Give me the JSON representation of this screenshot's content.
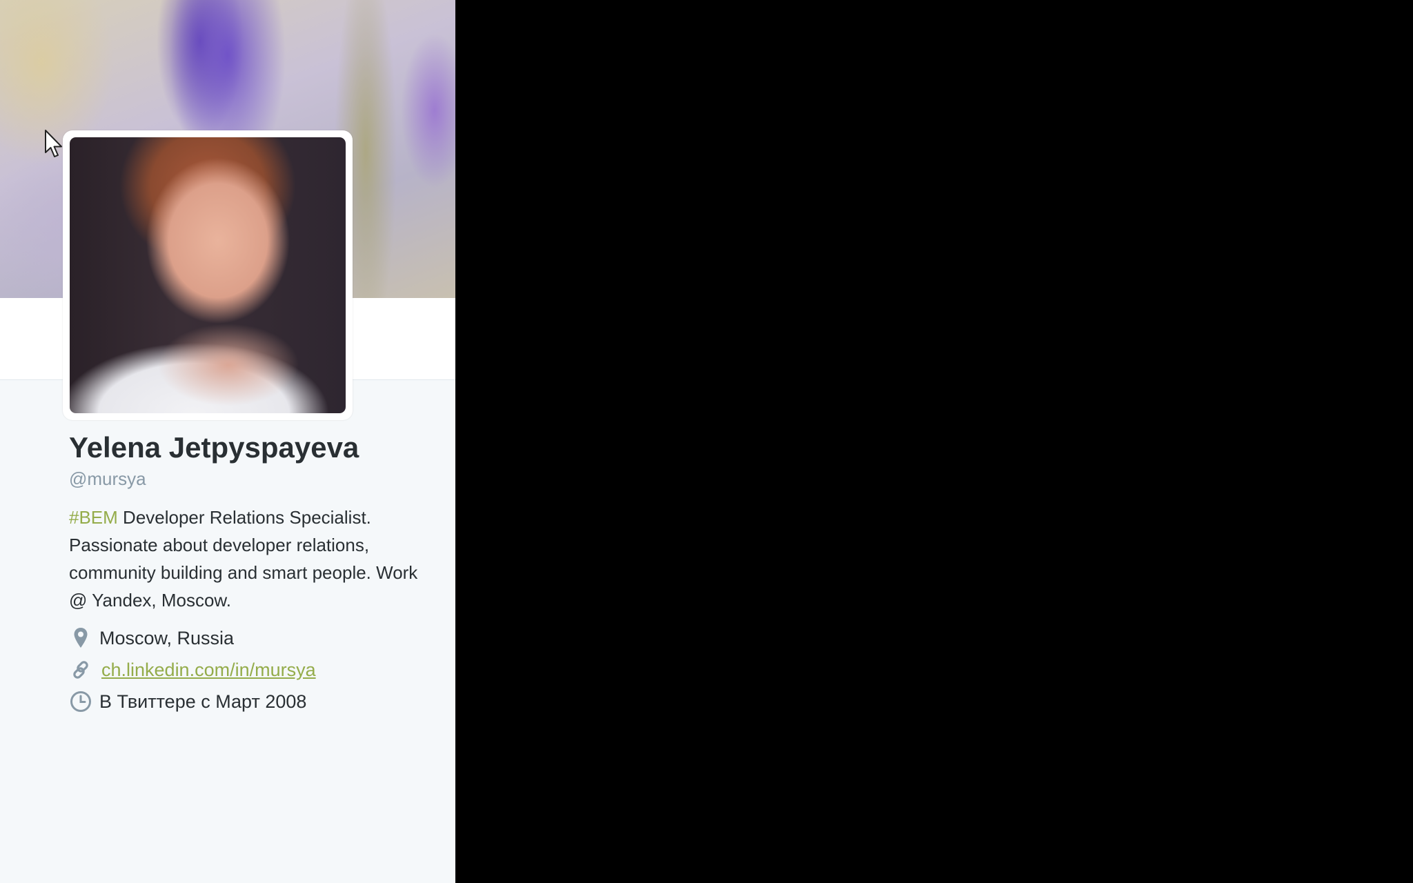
{
  "profile": {
    "name": "Yelena Jetpyspayeva",
    "handle": "@mursya",
    "bio": {
      "hashtag": "#BEM",
      "text": " Developer Relations Specialist. Passionate about developer relations, community building and smart people. Work @ Yandex, Moscow."
    },
    "location": "Moscow, Russia",
    "url": "ch.linkedin.com/in/mursya",
    "joined": "В Твиттере с Март 2008"
  },
  "icons": {
    "location": "map-pin-icon",
    "url": "link-icon",
    "joined": "clock-icon",
    "pointer": "mouse-cursor"
  },
  "colors": {
    "accent": "#94ac4a",
    "text": "#292f33",
    "muted": "#8899a6",
    "panel_bg": "#f5f8fa",
    "outside_bg": "#000000"
  }
}
